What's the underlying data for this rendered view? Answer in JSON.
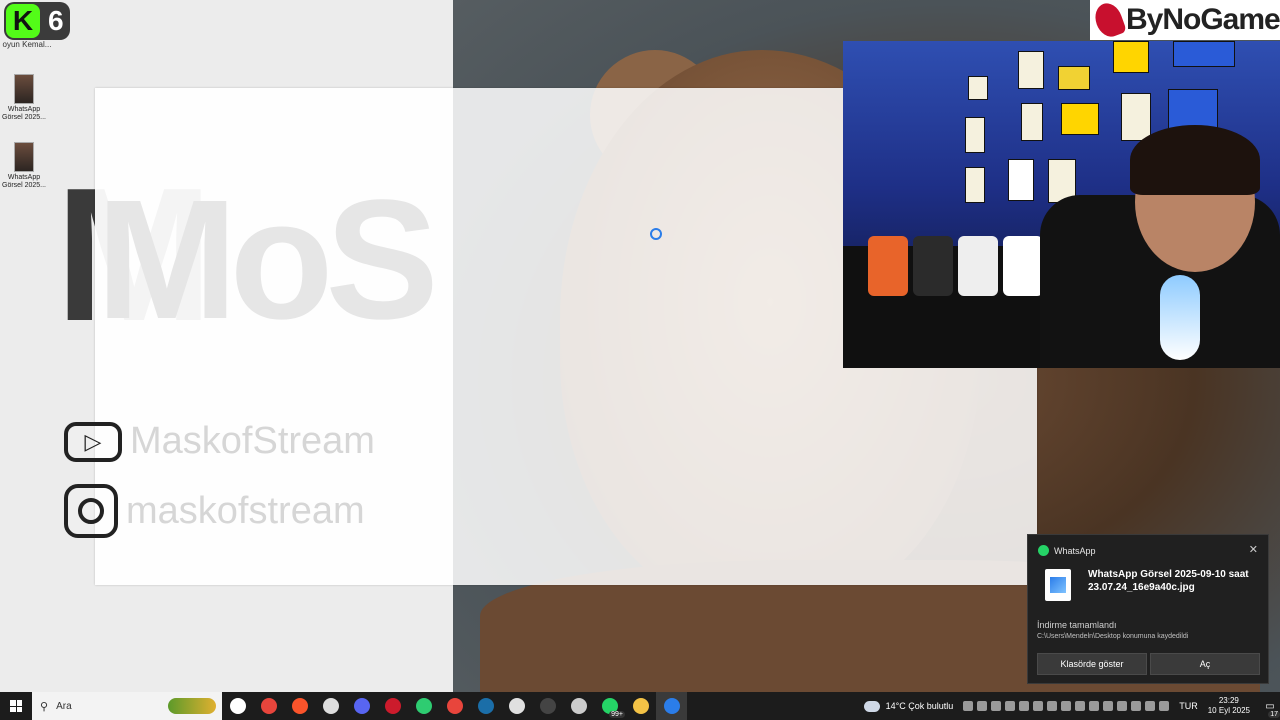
{
  "kick": {
    "logo": "K",
    "count": "6",
    "label": "oyun Kemal..."
  },
  "desktop_icons": [
    {
      "label": "WhatsApp Görsel 2025..."
    },
    {
      "label": "WhatsApp Görsel 2025..."
    }
  ],
  "background": {
    "big_text": "M"
  },
  "overlay": {
    "logo_text": "MoS"
  },
  "socials": {
    "youtube": "MaskofStream",
    "instagram": "maskofstream"
  },
  "brand": {
    "name": "ByNoGame",
    "accent": "#c8102e"
  },
  "notification": {
    "app": "WhatsApp",
    "file_name": "WhatsApp Görsel 2025-09-10 saat 23.07.24_16e9a40c.jpg",
    "status": "İndirme tamamlandı",
    "path": "C:\\Users\\Mendeln\\Desktop konumuna kaydedildi",
    "btn_folder": "Klasörde göster",
    "btn_open": "Aç"
  },
  "taskbar": {
    "search_placeholder": "Ara",
    "apps": [
      {
        "icon": "task-view-icon",
        "color": "#ffffff"
      },
      {
        "icon": "chrome-icon",
        "color": "#e8453c"
      },
      {
        "icon": "brave-icon",
        "color": "#fb542b"
      },
      {
        "icon": "podcast-icon",
        "color": "#dddddd"
      },
      {
        "icon": "discord-icon",
        "color": "#5865f2"
      },
      {
        "icon": "opera-icon",
        "color": "#cc1b2c"
      },
      {
        "icon": "notion-icon",
        "color": "#2ecc71"
      },
      {
        "icon": "chrome-icon",
        "color": "#e8453c"
      },
      {
        "icon": "steam-icon",
        "color": "#1b6ea8"
      },
      {
        "icon": "settings-icon",
        "color": "#e0e0e0"
      },
      {
        "icon": "obs-icon",
        "color": "#444444"
      },
      {
        "icon": "app-icon",
        "color": "#cccccc"
      },
      {
        "icon": "whatsapp-icon",
        "color": "#25d366",
        "badge": "99+"
      },
      {
        "icon": "folder-icon",
        "color": "#f3c246"
      },
      {
        "icon": "photos-icon",
        "color": "#2b7de9"
      }
    ],
    "weather": "14°C  Çok bulutlu",
    "language": "TUR",
    "time": "23:29",
    "date": "10 Eyl 2025",
    "notification_count": "17"
  }
}
